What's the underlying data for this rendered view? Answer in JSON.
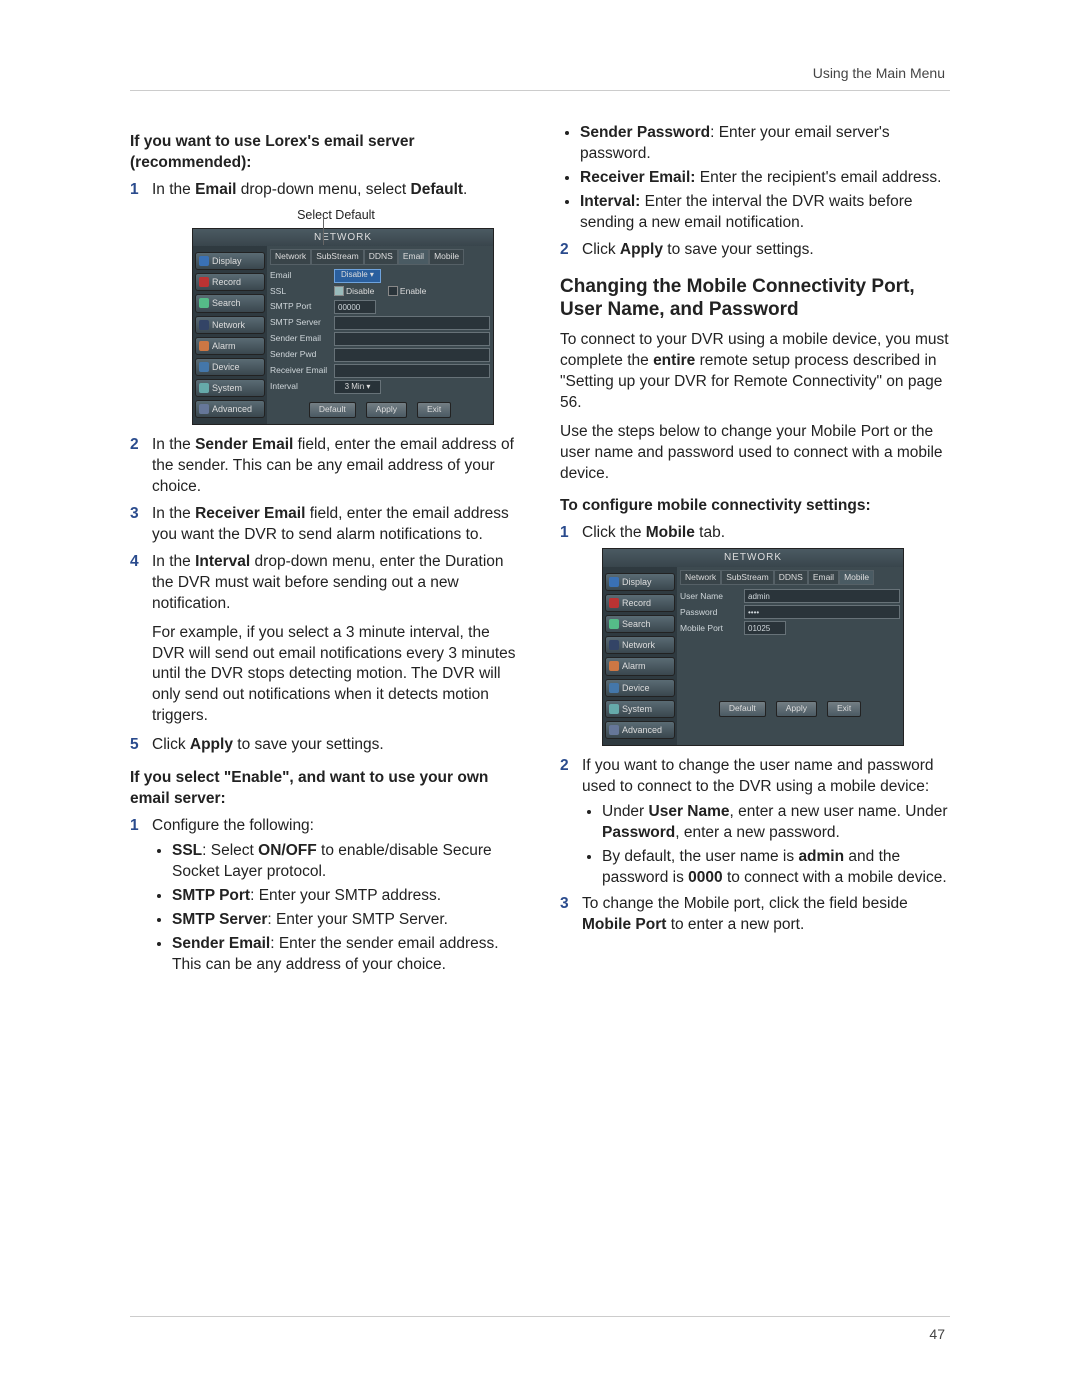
{
  "header": "Using the Main Menu",
  "page_number": "47",
  "left": {
    "head1": "If you want to use Lorex's email server (recommended):",
    "step1_pre": "In the ",
    "step1_b1": "Email",
    "step1_mid": " drop-down menu, select ",
    "step1_b2": "Default",
    "step1_post": ".",
    "caption1": "Select Default",
    "dvr1": {
      "title": "NETWORK",
      "side": [
        "Display",
        "Record",
        "Search",
        "Network",
        "Alarm",
        "Device",
        "System",
        "Advanced"
      ],
      "tabs": [
        "Network",
        "SubStream",
        "DDNS",
        "Email",
        "Mobile"
      ],
      "rows": {
        "email": "Email",
        "email_sel": "Disable ▾",
        "ssl": "SSL",
        "ssl_disable": "Disable",
        "ssl_enable": "Enable",
        "smtp_port": "SMTP Port",
        "smtp_port_val": "00000",
        "smtp_server": "SMTP Server",
        "sender_email": "Sender Email",
        "sender_pwd": "Sender Pwd",
        "receiver": "Receiver Email",
        "interval": "Interval",
        "interval_val": "3 Min ▾"
      },
      "buttons": [
        "Default",
        "Apply",
        "Exit"
      ]
    },
    "step2_pre": "In the ",
    "step2_b": "Sender Email",
    "step2_post": " field, enter the email address of the sender. This can be any email address of your choice.",
    "step3_pre": "In the ",
    "step3_b": "Receiver Email",
    "step3_post": " field, enter the email address you want the DVR to send alarm notifications to.",
    "step4_pre": "In the ",
    "step4_b": "Interval",
    "step4_post": " drop-down menu, enter the Duration the DVR must wait before sending out a new notification.",
    "para4b": "For example, if you select a 3 minute interval, the DVR will send out email notifications every 3 minutes until the DVR stops detecting motion. The DVR will only send out notifications when it detects motion triggers.",
    "step5_pre": "Click ",
    "step5_b": "Apply",
    "step5_post": " to save your settings.",
    "head2": "If you select \"Enable\", and want to use your own email server:",
    "cfg1": "Configure the following:",
    "ssl_b": "SSL",
    "ssl_t1": ": Select ",
    "ssl_b2": "ON/OFF",
    "ssl_t2": " to enable/disable Secure Socket Layer protocol.",
    "smtpport_b": "SMTP Port",
    "smtpport_t": ": Enter your SMTP address.",
    "smtpserver_b": "SMTP Server",
    "smtpserver_t": ": Enter your SMTP Server.",
    "senderem_b": "Sender Email",
    "senderem_t": ": Enter the sender email address. This can be any address of your choice."
  },
  "right": {
    "senderpw_b": "Sender Password",
    "senderpw_t": ": Enter your email server's password.",
    "rcv_b": "Receiver Email:",
    "rcv_t": " Enter the recipient's email address.",
    "int_b": "Interval:",
    "int_t": " Enter the interval the DVR waits before sending a new email notification.",
    "apply2_pre": "Click ",
    "apply2_b": "Apply",
    "apply2_post": " to save your settings.",
    "h2": "Changing the Mobile Connectivity Port, User Name, and Password",
    "p1_pre": "To connect to your DVR using a mobile device, you must complete the ",
    "p1_b": "entire",
    "p1_post": " remote setup process described in \"Setting up your DVR for Remote Connectivity\" on page 56.",
    "p2": "Use the steps below to change your Mobile Port or the user name and password used to connect with a mobile device.",
    "head3": "To configure mobile connectivity settings:",
    "m1_pre": "Click the ",
    "m1_b": "Mobile",
    "m1_post": " tab.",
    "dvr2": {
      "title": "NETWORK",
      "side": [
        "Display",
        "Record",
        "Search",
        "Network",
        "Alarm",
        "Device",
        "System",
        "Advanced"
      ],
      "tabs": [
        "Network",
        "SubStream",
        "DDNS",
        "Email",
        "Mobile"
      ],
      "rows": {
        "user": "User Name",
        "user_val": "admin",
        "pwd": "Password",
        "pwd_val": "••••",
        "port": "Mobile Port",
        "port_val": "01025"
      },
      "buttons": [
        "Default",
        "Apply",
        "Exit"
      ]
    },
    "m2": "If you want to change the user name and password used to connect to the DVR using a mobile device:",
    "m2b1_pre": "Under ",
    "m2b1_b1": "User Name",
    "m2b1_mid": ", enter a new user name. Under ",
    "m2b1_b2": "Password",
    "m2b1_post": ", enter a new password.",
    "m2b2_pre": "By default, the user name is ",
    "m2b2_b1": "admin",
    "m2b2_mid": " and the password is ",
    "m2b2_b2": "0000",
    "m2b2_post": " to connect with a mobile device.",
    "m3_pre": "To change the Mobile port, click the field beside ",
    "m3_b": "Mobile Port",
    "m3_post": " to enter a new port."
  }
}
